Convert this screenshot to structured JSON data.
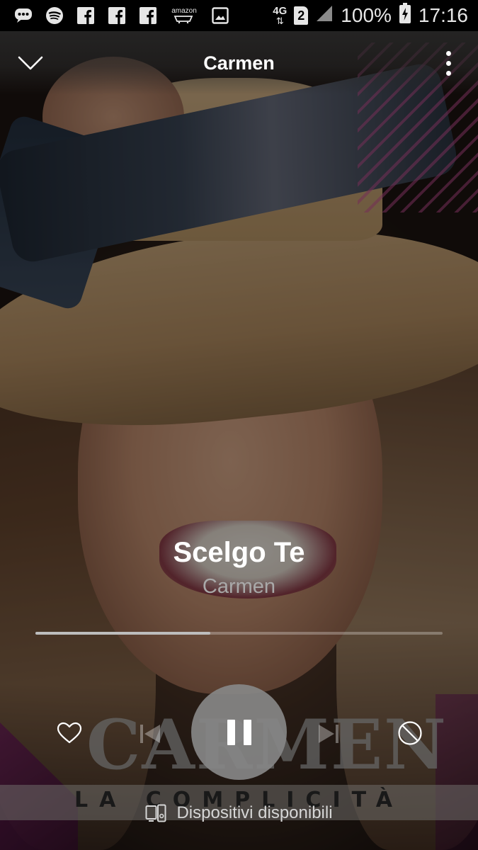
{
  "status_bar": {
    "network": "4G",
    "sim_slot": "2",
    "battery": "100%",
    "time": "17:16",
    "notification_icons": [
      "messages-icon",
      "spotify-icon",
      "facebook-icon",
      "facebook-icon",
      "facebook-icon",
      "amazon-icon",
      "gallery-icon"
    ],
    "amazon_text": "amazon"
  },
  "header": {
    "context_title": "Carmen"
  },
  "now_playing": {
    "title": "Scelgo Te",
    "artist": "Carmen",
    "progress_fraction": 0.43
  },
  "album_art": {
    "logo_text": "CARMEN",
    "banner_text": "LA COMPLICITÀ"
  },
  "controls": {
    "like": "heart-icon",
    "previous": "previous-icon",
    "play_pause": "pause-icon",
    "next": "next-icon",
    "ban": "ban-icon"
  },
  "devices": {
    "label": "Dispositivi disponibili"
  },
  "colors": {
    "accent": "#ffffff",
    "secondary_text": "#a9a9a9",
    "play_button": "#878787"
  }
}
